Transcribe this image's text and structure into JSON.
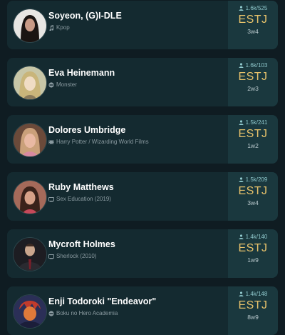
{
  "accent_type_color": "#e7c26b",
  "cards": [
    {
      "name": "Soyeon, (G)I-DLE",
      "source": "Kpop",
      "source_icon": "music-icon",
      "votes": "1.6k/525",
      "type": "ESTJ",
      "wing": "3w4",
      "avatar_palette": [
        "#e8e6e3",
        "#1a1412",
        "#c99a86"
      ]
    },
    {
      "name": "Eva Heinemann",
      "source": "Monster",
      "source_icon": "anime-icon",
      "votes": "1.6k/103",
      "type": "ESTJ",
      "wing": "2w3",
      "avatar_palette": [
        "#c7c6a7",
        "#c9b57a",
        "#f0dcc4"
      ]
    },
    {
      "name": "Dolores Umbridge",
      "source": "Harry Potter / Wizarding World Films",
      "source_icon": "movie-icon",
      "votes": "1.5k/241",
      "type": "ESTJ",
      "wing": "1w2",
      "avatar_palette": [
        "#6b4a3a",
        "#caa07a",
        "#e9b9a3"
      ]
    },
    {
      "name": "Ruby Matthews",
      "source": "Sex Education (2019)",
      "source_icon": "tv-icon",
      "votes": "1.5k/209",
      "type": "ESTJ",
      "wing": "3w4",
      "avatar_palette": [
        "#a56a5a",
        "#3a221a",
        "#d7a188"
      ]
    },
    {
      "name": "Mycroft Holmes",
      "source": "Sherlock (2010)",
      "source_icon": "tv-icon",
      "votes": "1.4k/140",
      "type": "ESTJ",
      "wing": "1w9",
      "avatar_palette": [
        "#1d1d22",
        "#2a2a30",
        "#c9a68d"
      ]
    },
    {
      "name": "Enji Todoroki \"Endeavor\"",
      "source": "Boku no Hero Academia",
      "source_icon": "anime-icon",
      "votes": "1.4k/148",
      "type": "ESTJ",
      "wing": "8w9",
      "avatar_palette": [
        "#2b2f57",
        "#c23b2c",
        "#e07a3a"
      ]
    }
  ]
}
